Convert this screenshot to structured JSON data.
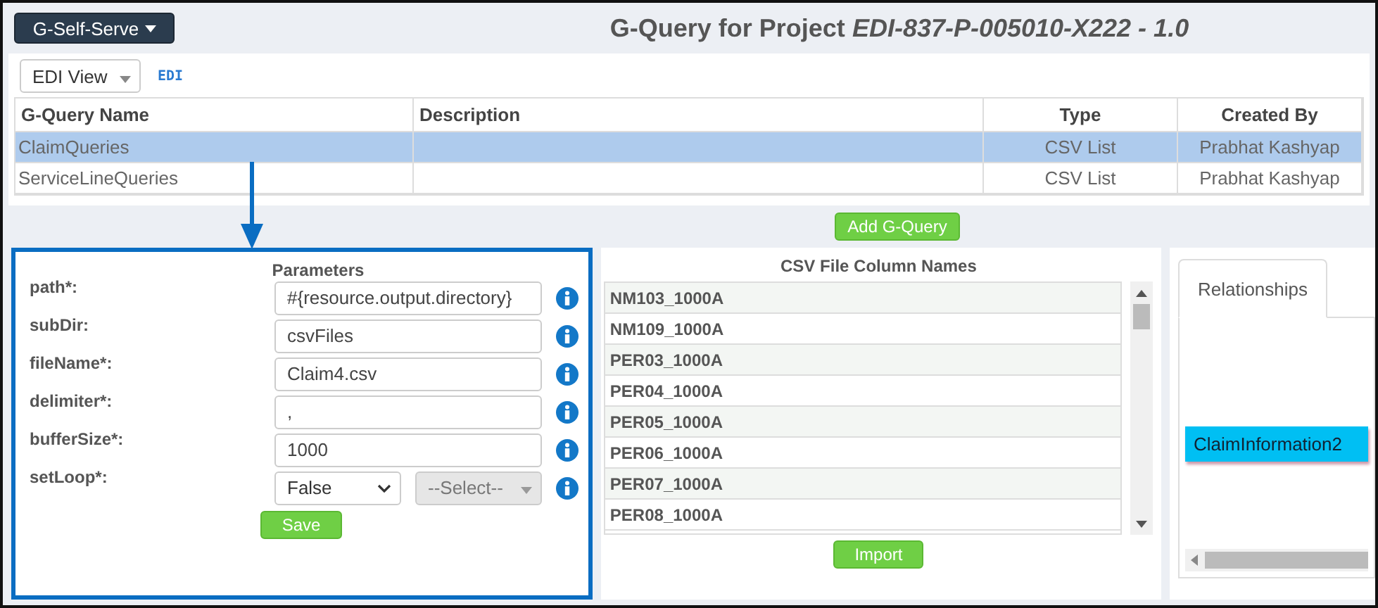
{
  "header": {
    "menu_button": "G-Self-Serve",
    "title": "G-Query for Project *EDI-837-P-005010-X222 - 1.0*"
  },
  "view_select": "EDI View",
  "edi_link": "EDI",
  "table": {
    "columns": [
      "G-Query Name",
      "Description",
      "Type",
      "Created By"
    ],
    "rows": [
      {
        "name": "ClaimQueries",
        "description": "",
        "type": "CSV List",
        "created_by": "Prabhat Kashyap",
        "selected": true
      },
      {
        "name": "ServiceLineQueries",
        "description": "",
        "type": "CSV List",
        "created_by": "Prabhat Kashyap",
        "selected": false
      }
    ]
  },
  "add_button": "Add G-Query",
  "parameters": {
    "title": "Parameters",
    "fields": [
      {
        "kind": "text",
        "label": "path*:",
        "value": "#{resource.output.directory}"
      },
      {
        "kind": "text",
        "label": "subDir:",
        "value": "csvFiles"
      },
      {
        "kind": "text",
        "label": "fileName*:",
        "value": "Claim4.csv"
      },
      {
        "kind": "text",
        "label": "delimiter*:",
        "value": ","
      },
      {
        "kind": "text",
        "label": "bufferSize*:",
        "value": "1000"
      },
      {
        "kind": "select",
        "label": "setLoop*:",
        "value": "False",
        "second": "--Select--"
      }
    ],
    "save": "Save"
  },
  "csv": {
    "title": "CSV File Column Names",
    "items": [
      "NM103_1000A",
      "NM109_1000A",
      "PER03_1000A",
      "PER04_1000A",
      "PER05_1000A",
      "PER06_1000A",
      "PER07_1000A",
      "PER08_1000A"
    ],
    "import": "Import"
  },
  "relationships": {
    "tabs": [
      {
        "label": "Relationships",
        "selected": true
      }
    ],
    "nodes": [
      "ClaimInformation2"
    ]
  }
}
